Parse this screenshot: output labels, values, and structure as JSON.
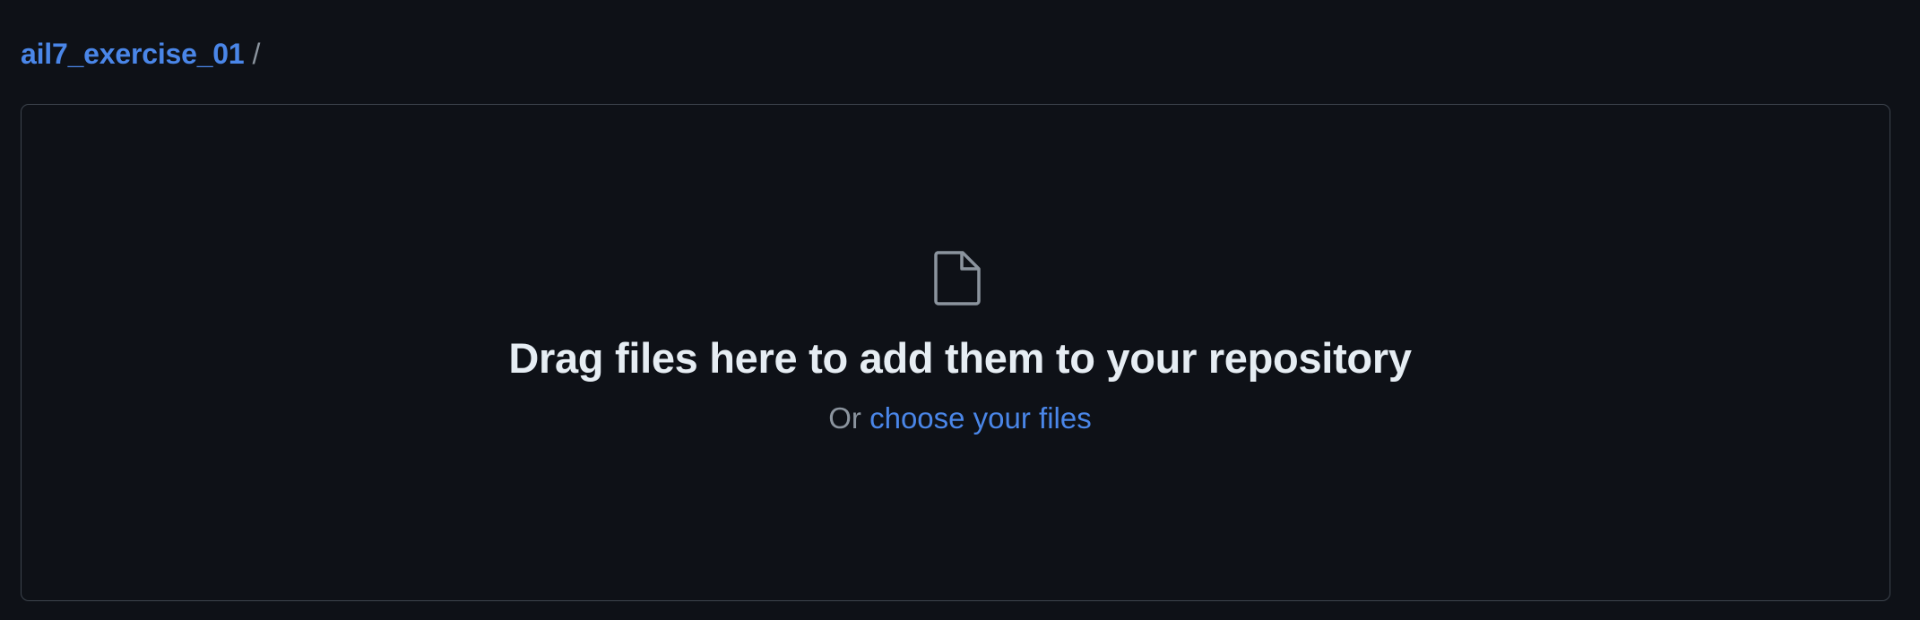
{
  "breadcrumb": {
    "repo": "ail7_exercise_01",
    "separator": "/"
  },
  "dropzone": {
    "icon": "file-icon",
    "headline": "Drag files here to add them to your repository",
    "or_text": "Or",
    "choose_link": "choose your files"
  },
  "colors": {
    "background": "#0e1117",
    "link": "#4a86e8",
    "text": "#e6edf3",
    "muted": "#8b949e",
    "border": "#3d444d"
  }
}
